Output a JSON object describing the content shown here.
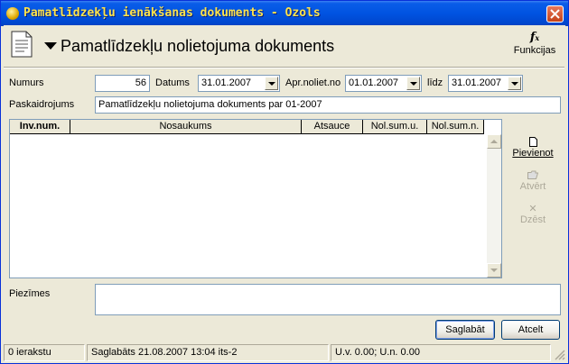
{
  "window": {
    "title": "Pamatlīdzekļu ienākšanas dokuments - Ozols"
  },
  "header": {
    "title": "Pamatlīdzekļu nolietojuma dokuments",
    "functions_label": "Funkcijas",
    "functions_icon": "fx-icon"
  },
  "form": {
    "numurs_label": "Numurs",
    "numurs_value": "56",
    "datums_label": "Datums",
    "datums_value": "31.01.2007",
    "apr_label": "Apr.noliet.no",
    "apr_value": "01.01.2007",
    "lidz_label": "līdz",
    "lidz_value": "31.01.2007",
    "paskaidrojums_label": "Paskaidrojums",
    "paskaidrojums_value": "Pamatlīdzekļu nolietojuma dokuments par 01-2007",
    "piezimes_label": "Piezīmes",
    "piezimes_value": ""
  },
  "grid": {
    "columns": [
      "Inv.num.",
      "Nosaukums",
      "Atsauce",
      "Nol.sum.u.",
      "Nol.sum.n."
    ],
    "rows": []
  },
  "side_buttons": {
    "add": "Pievienot",
    "open": "Atvērt",
    "delete": "Dzēst"
  },
  "buttons": {
    "save": "Saglabāt",
    "cancel": "Atcelt"
  },
  "status": {
    "records": "0 ierakstu",
    "saved": "Saglabāts 21.08.2007 13:04 its-2",
    "totals": "U.v. 0.00; U.n. 0.00"
  },
  "colors": {
    "title_text": "#FFE34A",
    "titlebar": "#0053E1",
    "face": "#ECE9D8"
  }
}
